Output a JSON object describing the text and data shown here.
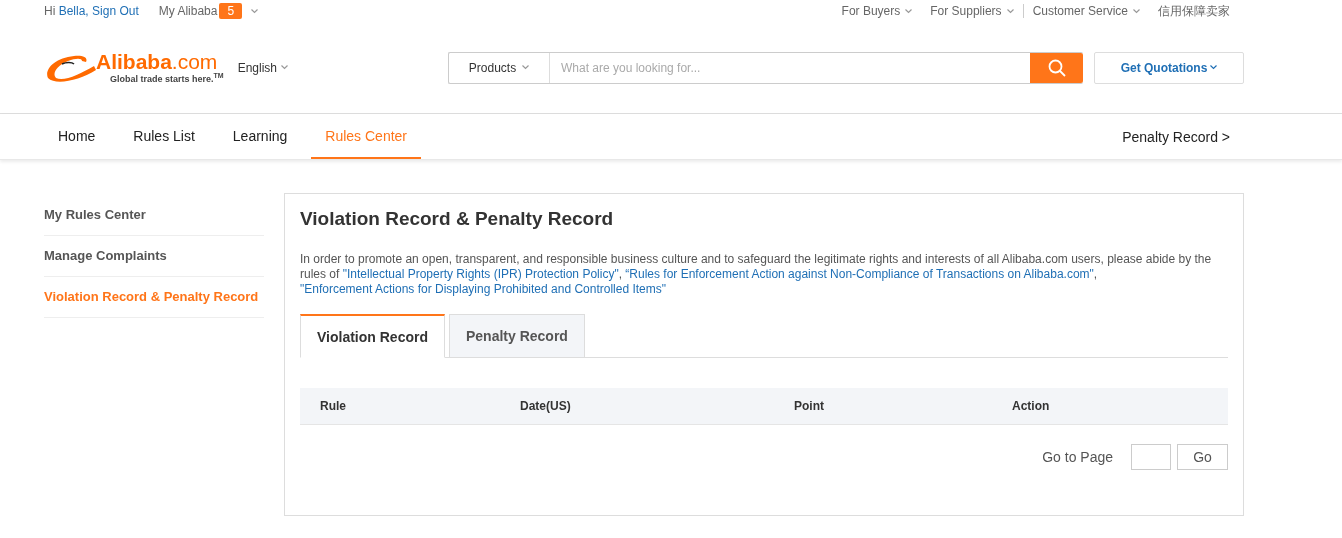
{
  "top_bar": {
    "greeting": "Hi",
    "user": "Bella,",
    "sign_out": "Sign Out",
    "my_alibaba": "My Alibaba",
    "badge": "5",
    "right_links": [
      {
        "label": "For Buyers",
        "dropdown": true
      },
      {
        "label": "For Suppliers",
        "dropdown": true
      },
      {
        "label": "Customer Service",
        "dropdown": true
      },
      {
        "label": "信用保障卖家",
        "dropdown": false
      }
    ]
  },
  "header": {
    "logo_name": "Alibaba",
    "logo_suffix": ".com",
    "logo_tagline": "Global trade starts here.",
    "logo_tm": "TM",
    "language": "English",
    "search_category": "Products",
    "search_placeholder": "What are you looking for...",
    "quotations": "Get Quotations"
  },
  "nav": {
    "items": [
      {
        "label": "Home",
        "selected": false
      },
      {
        "label": "Rules List",
        "selected": false
      },
      {
        "label": "Learning",
        "selected": false
      },
      {
        "label": "Rules Center",
        "selected": true
      }
    ],
    "right_link": "Penalty Record >"
  },
  "sidebar": {
    "items": [
      {
        "label": "My Rules Center",
        "selected": false
      },
      {
        "label": "Manage Complaints",
        "selected": false
      },
      {
        "label": "Violation Record & Penalty Record",
        "selected": true
      }
    ]
  },
  "panel": {
    "title": "Violation Record & Penalty Record",
    "intro": [
      {
        "kind": "text",
        "text": "In order to promote an open, transparent, and responsible business culture and to safeguard the legitimate rights and interests of all Alibaba.com users, please abide by the rules of "
      },
      {
        "kind": "link",
        "text": "\"Intellectual Property Rights (IPR) Protection Policy\""
      },
      {
        "kind": "text",
        "text": ", "
      },
      {
        "kind": "link",
        "text": "“Rules for Enforcement Action against Non-Compliance of Transactions on Alibaba.com\""
      },
      {
        "kind": "text",
        "text": ", "
      },
      {
        "kind": "link",
        "text": "\"Enforcement Actions for Displaying Prohibited and Controlled Items\""
      }
    ],
    "tabs": [
      {
        "label": "Violation Record",
        "selected": true
      },
      {
        "label": "Penalty Record",
        "selected": false
      }
    ],
    "table": {
      "columns": [
        "Rule",
        "Date(US)",
        "Point",
        "Action"
      ]
    },
    "pager": {
      "label": "Go to Page",
      "button": "Go"
    }
  }
}
